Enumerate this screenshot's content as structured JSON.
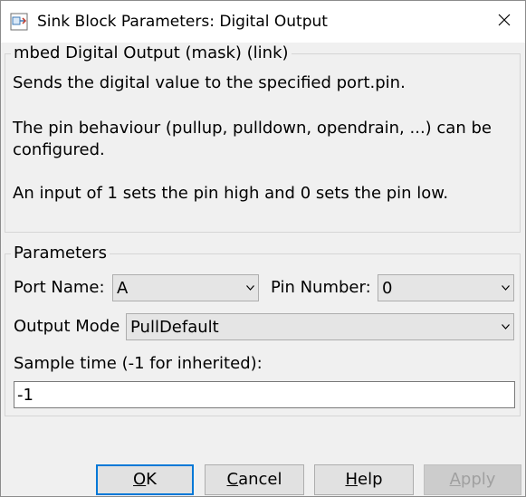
{
  "window": {
    "title": "Sink Block Parameters: Digital Output"
  },
  "description": {
    "group_title": "mbed Digital Output (mask) (link)",
    "line1": "Sends the digital value to the specified port.pin.",
    "line2": "The pin behaviour (pullup, pulldown, opendrain, ...) can be",
    "line3": "configured.",
    "line4": "An input of 1 sets the pin high and 0 sets the pin low."
  },
  "parameters": {
    "group_title": "Parameters",
    "port_name_label": "Port Name:",
    "port_name_value": "A",
    "pin_number_label": "Pin Number:",
    "pin_number_value": "0",
    "output_mode_label": "Output Mode",
    "output_mode_value": "PullDefault",
    "sample_time_label": "Sample time (-1 for inherited):",
    "sample_time_value": "-1"
  },
  "buttons": {
    "ok": {
      "mnemonic": "O",
      "rest": "K"
    },
    "cancel": {
      "mnemonic": "C",
      "rest": "ancel"
    },
    "help": {
      "mnemonic": "H",
      "rest": "elp"
    },
    "apply": {
      "mnemonic": "A",
      "rest": "pply",
      "enabled": false
    }
  },
  "colors": {
    "focus_border": "#0078d7",
    "dialog_bg": "#f0f0f0",
    "disabled_text": "#a0a0a0"
  },
  "icons": [
    "simulink-block-icon",
    "close-icon",
    "chevron-down-icon"
  ]
}
